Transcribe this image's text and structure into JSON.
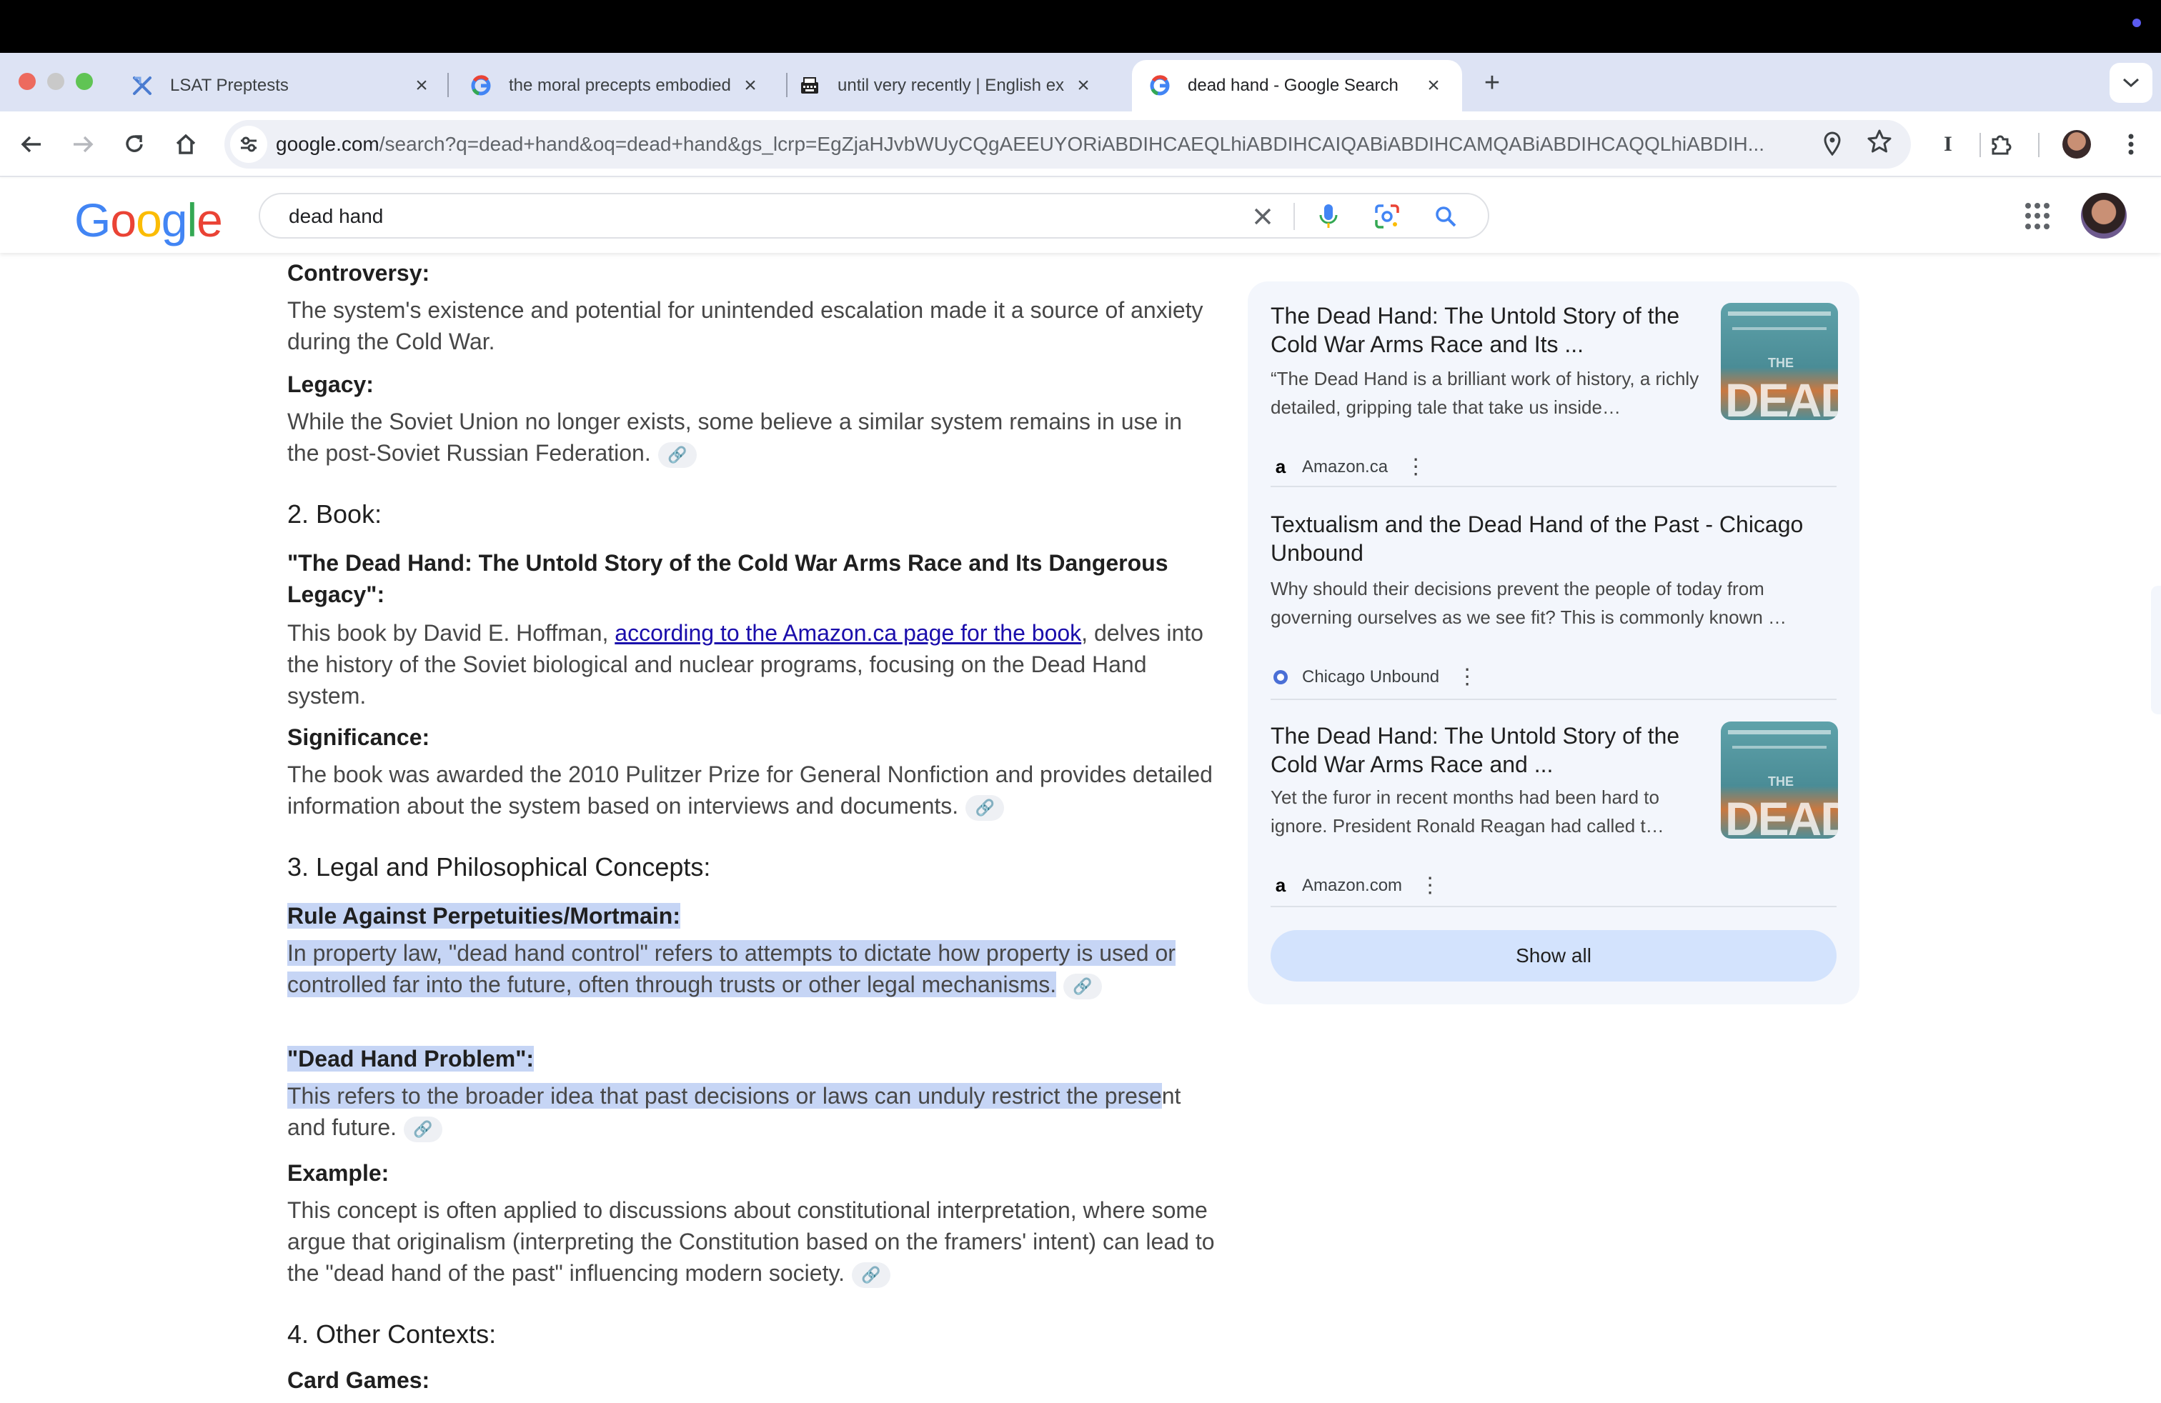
{
  "browser": {
    "tabs": [
      {
        "title": "LSAT Preptests",
        "favicon": "lsat-icon",
        "active": false
      },
      {
        "title": "the moral precepts embodied",
        "favicon": "google-icon",
        "active": false
      },
      {
        "title": "until very recently | English ex",
        "favicon": "typewriter-icon",
        "active": false
      },
      {
        "title": "dead hand - Google Search",
        "favicon": "google-icon",
        "active": true
      }
    ],
    "url_host": "google.com",
    "url_rest": "/search?q=dead+hand&oq=dead+hand&gs_lcrp=EgZjaHJvbWUyCQgAEEUYORiABDIHCAEQLhiABDIHCAIQABiABDIHCAMQABiABDIHCAQQLhiABDIH..."
  },
  "search": {
    "query": "dead hand",
    "logo": "Google"
  },
  "content": {
    "controversy_label": "Controversy:",
    "controversy_text": "The system's existence and potential for unintended escalation made it a source of anxiety during the Cold War.",
    "legacy_label": "Legacy:",
    "legacy_text": "While the Soviet Union no longer exists, some believe a similar system remains in use in the post-Soviet Russian Federation.",
    "section2": "2. Book:",
    "book_title": "\"The Dead Hand: The Untold Story of the Cold War Arms Race and Its Dangerous Legacy\":",
    "book_text_before": "This book by David E. Hoffman, ",
    "book_link": "according to the Amazon.ca page for the book",
    "book_text_after": ", delves into the history of the Soviet biological and nuclear programs, focusing on the Dead Hand system.",
    "significance_label": "Significance:",
    "significance_text": "The book was awarded the 2010 Pulitzer Prize for General Nonfiction and provides detailed information about the system based on interviews and documents.",
    "section3": "3. Legal and Philosophical Concepts:",
    "rule_label": "Rule Against Perpetuities/Mortmain:",
    "rule_text": "In property law, \"dead hand control\" refers to attempts to dictate how property is used or controlled far into the future, often through trusts or other legal mechanisms.",
    "problem_label": "\"Dead Hand Problem\":",
    "problem_text_hl": "This refers to the broader idea that past decisions or laws can unduly restrict the prese",
    "problem_text_rest": "nt and future.",
    "example_label": "Example:",
    "example_text": "This concept is often applied to discussions about constitutional interpretation, where some argue that originalism (interpreting the Constitution based on the framers' intent) can lead to the \"dead hand of the past\" influencing modern society.",
    "section4": "4. Other Contexts:",
    "cardgames_label": "Card Games:"
  },
  "sources": {
    "items": [
      {
        "title": "The Dead Hand: The Untold Story of the Cold War Arms Race and Its ...",
        "snippet": "“The Dead Hand is a brilliant work of history, a richly detailed, gripping tale that take us inside…",
        "source": "Amazon.ca",
        "thumb_word": "THE",
        "thumb_big": "DEAD"
      },
      {
        "title": "Textualism and the Dead Hand of the Past - Chicago Unbound",
        "snippet": "Why should their decisions prevent the people of today from governing ourselves as we see fit? This is commonly known …",
        "source": "Chicago Unbound"
      },
      {
        "title": "The Dead Hand: The Untold Story of the Cold War Arms Race and ...",
        "snippet": "Yet the furor in recent months had been hard to ignore. President Ronald Reagan had called t…",
        "source": "Amazon.com",
        "thumb_word": "THE",
        "thumb_big": "DEAD"
      }
    ],
    "show_all": "Show all"
  },
  "colors": {
    "highlight": "#c6d5f5",
    "link": "#1a0dab",
    "panel_bg": "#f3f6fc",
    "show_all_bg": "#d3e3fd"
  }
}
